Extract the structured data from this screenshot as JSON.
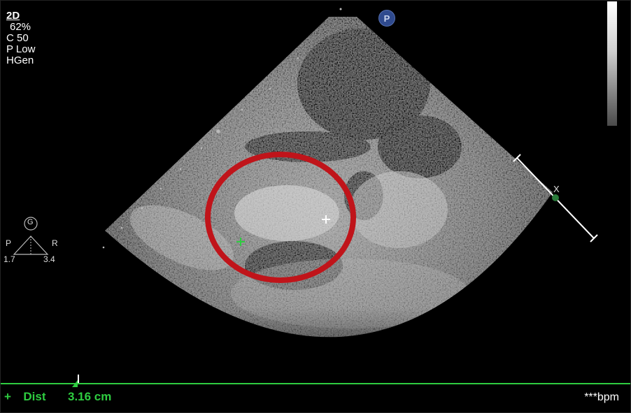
{
  "mode_panel": {
    "mode": "2D",
    "gain": "62%",
    "compression": "C 50",
    "power": "P Low",
    "harmonic": "HGen"
  },
  "probe_marker": {
    "label": "P"
  },
  "orientation": {
    "g_label": "G",
    "left_label": "P",
    "right_label": "R",
    "left_value": "1.7",
    "right_value": "3.4"
  },
  "depth_scale": {
    "label": "X"
  },
  "measurement": {
    "label": "Dist",
    "value": "3.16 cm",
    "color": "#2ecc40"
  },
  "heart_rate": {
    "text": "***bpm"
  },
  "annotation": {
    "color": "#c0141a"
  }
}
